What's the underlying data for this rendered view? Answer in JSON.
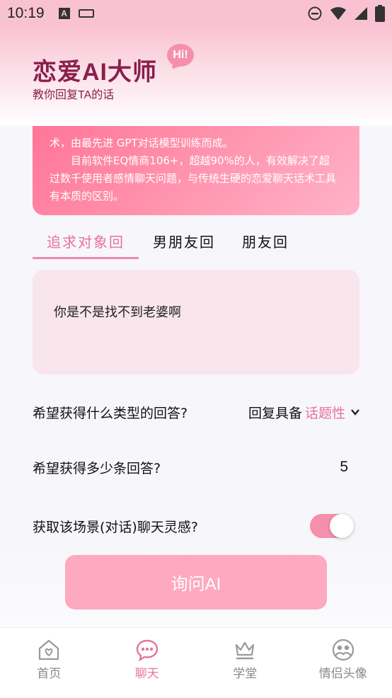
{
  "status_bar": {
    "time": "10:19",
    "a_glyph": "A"
  },
  "header": {
    "title": "恋爱AI大师",
    "hi_badge": "Hi!",
    "subtitle": "教你回复TA的话"
  },
  "intro": {
    "paragraph1": "术，由最先进 GPT对话模型训练而成。",
    "paragraph2": "目前软件EQ情商106+，超越90%的人，有效解决了超过数千使用者感情聊天问题，与传统生硬的恋爱聊天话术工具有本质的区别。"
  },
  "tabs": [
    {
      "label": "追求对象回",
      "active": true
    },
    {
      "label": "男朋友回",
      "active": false
    },
    {
      "label": "朋友回",
      "active": false
    }
  ],
  "input": {
    "value": "你是不是找不到老婆啊"
  },
  "options": {
    "answer_type": {
      "label": "希望获得什么类型的回答?",
      "prefix": "回复具备",
      "value": "话题性"
    },
    "answer_count": {
      "label": "希望获得多少条回答?",
      "value": "5"
    },
    "inspiration": {
      "label": "获取该场景(对话)聊天灵感?",
      "enabled": true
    }
  },
  "ask_button": {
    "label": "询问AI"
  },
  "bottom_nav": [
    {
      "label": "首页",
      "icon": "home-heart-icon",
      "active": false
    },
    {
      "label": "聊天",
      "icon": "chat-bubble-icon",
      "active": true
    },
    {
      "label": "学堂",
      "icon": "crown-icon",
      "active": false
    },
    {
      "label": "情侣头像",
      "icon": "couple-avatar-icon",
      "active": false
    }
  ],
  "colors": {
    "accent": "#e8739a",
    "brand": "#8a1f4b",
    "button": "#fda9c0"
  }
}
